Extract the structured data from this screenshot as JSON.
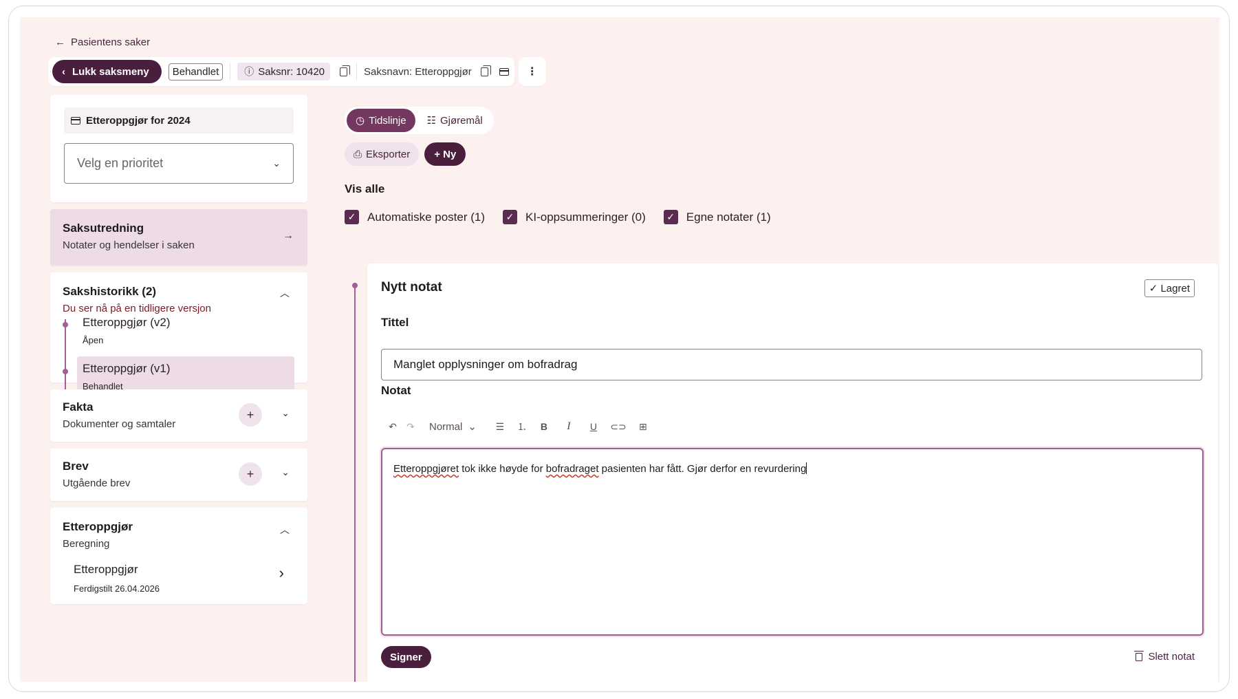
{
  "back_link": "Pasientens saker",
  "topbar": {
    "close_menu": "Lukk saksmeny",
    "status": "Behandlet",
    "case_no": "Saksnr: 10420",
    "case_name": "Saksnavn: Etteroppgjør"
  },
  "sidebar": {
    "case_title": "Etteroppgjør for 2024",
    "priority_placeholder": "Velg en prioritet",
    "investigation": {
      "title": "Saksutredning",
      "sub": "Notater og hendelser i saken"
    },
    "history": {
      "title": "Sakshistorikk (2)",
      "warning": "Du ser nå på en tidligere versjon",
      "items": [
        {
          "title": "Etteroppgjør (v2)",
          "status": "Åpen"
        },
        {
          "title": "Etteroppgjør (v1)",
          "status": "Behandlet"
        }
      ]
    },
    "facts": {
      "title": "Fakta",
      "sub": "Dokumenter og samtaler"
    },
    "letters": {
      "title": "Brev",
      "sub": "Utgående brev"
    },
    "settlement": {
      "title": "Etteroppgjør",
      "sub": "Beregning",
      "item_title": "Etteroppgjør",
      "item_sub": "Ferdigstilt 26.04.2026"
    }
  },
  "main": {
    "tabs": [
      {
        "label": "Tidslinje"
      },
      {
        "label": "Gjøremål"
      }
    ],
    "export": "Eksporter",
    "new": "+ Ny",
    "show_all": "Vis alle",
    "filters": [
      {
        "label": "Automatiske poster (1)"
      },
      {
        "label": "KI-oppsummeringer (0)"
      },
      {
        "label": "Egne notater (1)"
      }
    ]
  },
  "note": {
    "heading": "Nytt notat",
    "saved": "Lagret",
    "title_label": "Tittel",
    "title_value": "Manglet opplysninger om bofradrag",
    "note_label": "Notat",
    "format": "Normal",
    "text_w1": "Etteroppgjøret",
    "text_m1": " tok ikke høyde for ",
    "text_w2": "bofradraget",
    "text_m2": " pasienten har fått. Gjør derfor en revurdering",
    "sign": "Signer",
    "delete": "Slett notat"
  }
}
